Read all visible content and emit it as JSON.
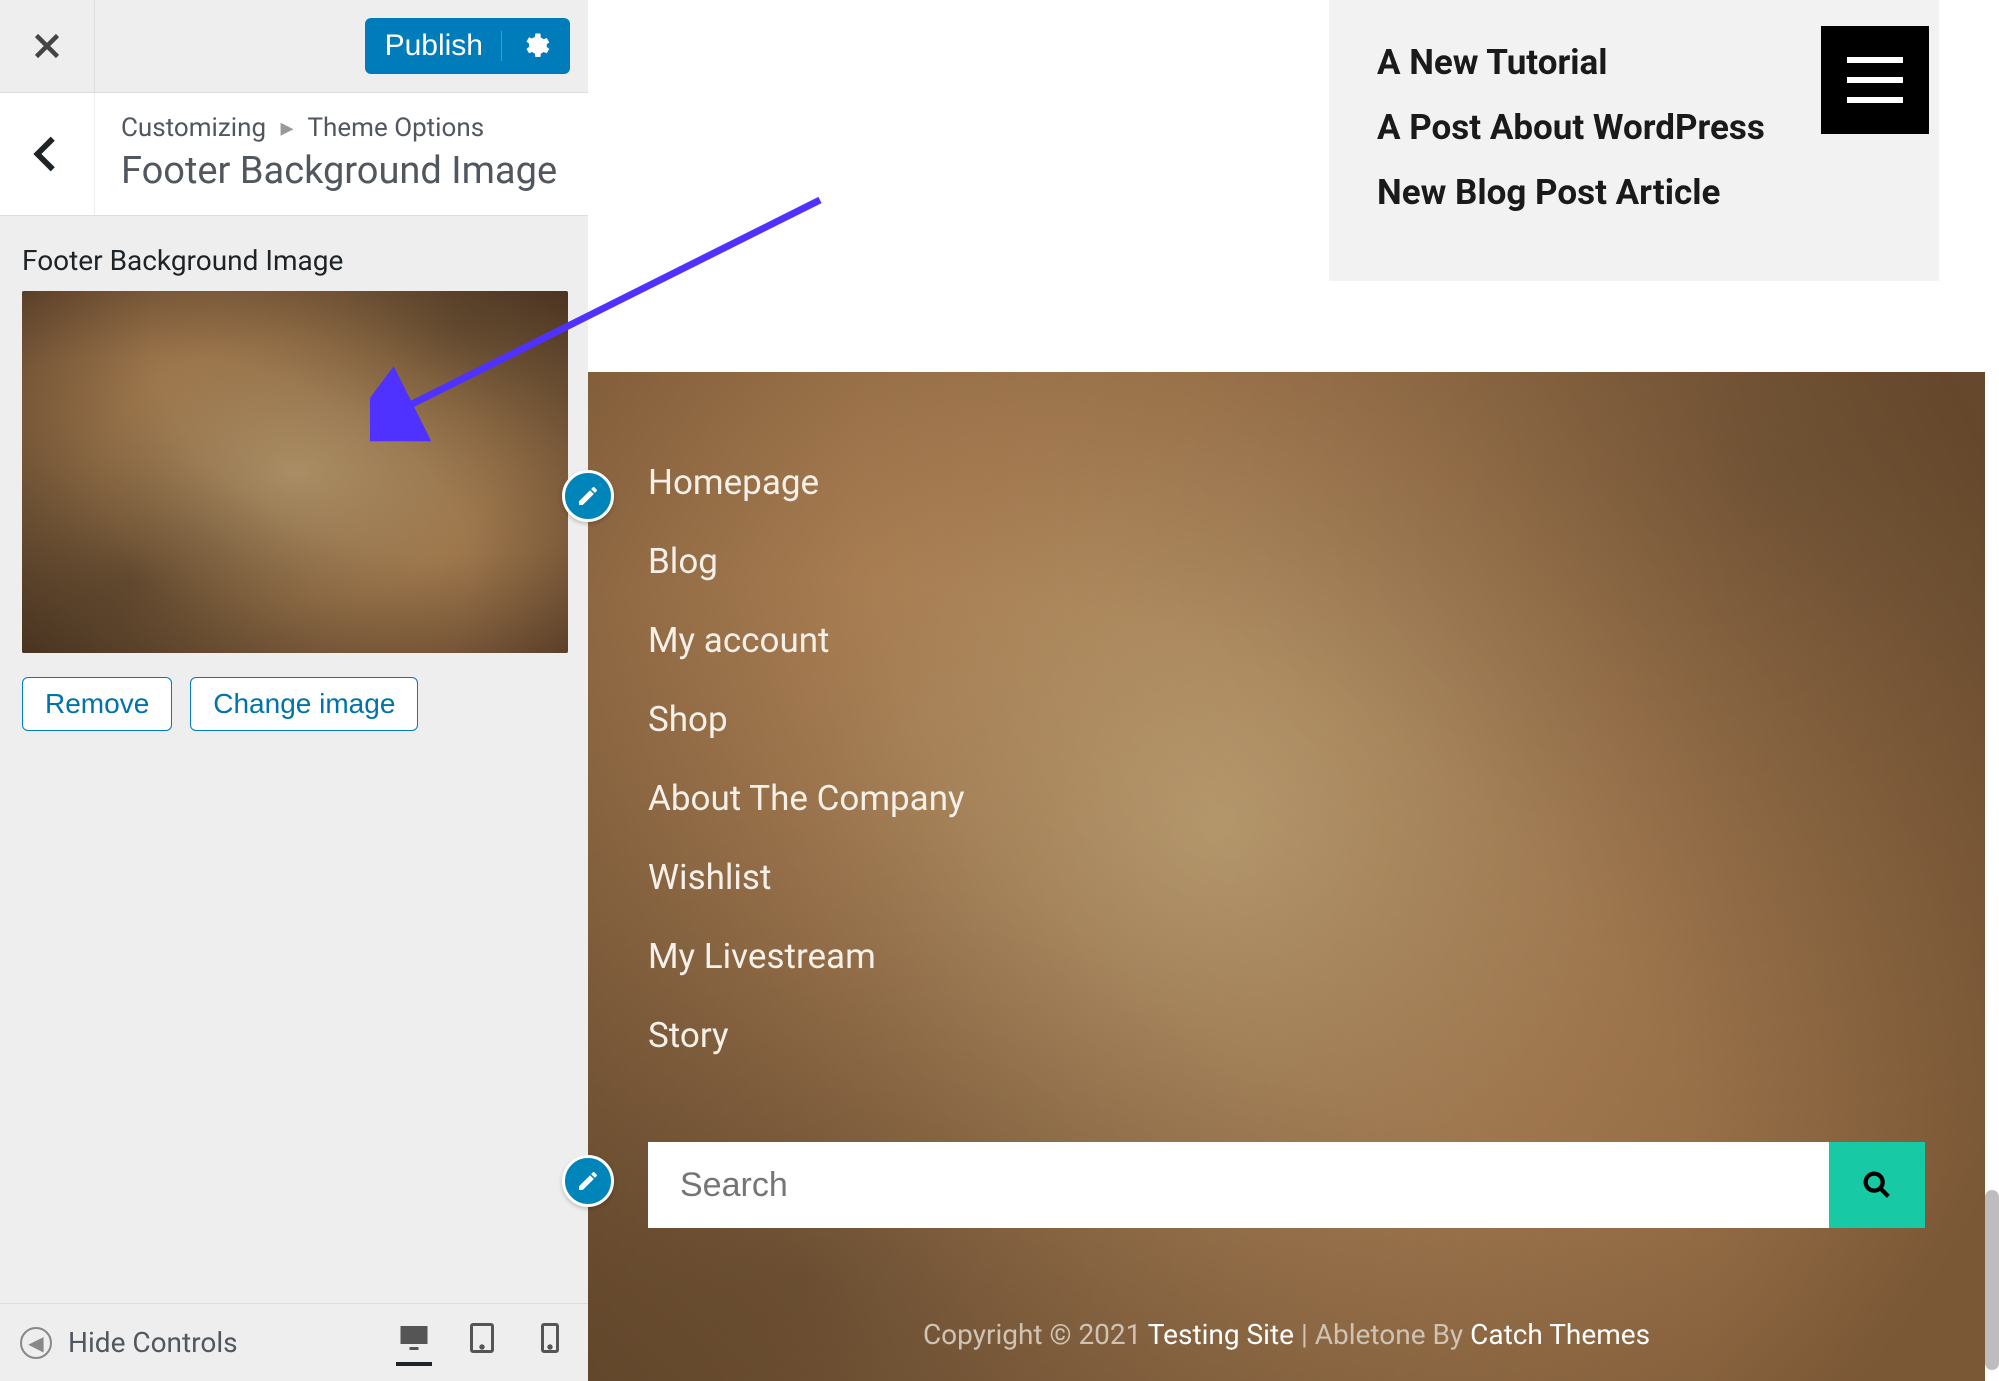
{
  "topbar": {
    "publish_label": "Publish"
  },
  "breadcrumb": {
    "root": "Customizing",
    "parent": "Theme Options"
  },
  "section_title": "Footer Background Image",
  "control": {
    "label": "Footer Background Image",
    "remove_label": "Remove",
    "change_label": "Change image"
  },
  "footerbar": {
    "hide_label": "Hide Controls"
  },
  "recent_posts": [
    "A New Tutorial",
    "A Post About WordPress",
    "New Blog Post Article"
  ],
  "footer_nav": [
    "Homepage",
    "Blog",
    "My account",
    "Shop",
    "About The Company",
    "Wishlist",
    "My Livestream",
    "Story"
  ],
  "search": {
    "placeholder": "Search"
  },
  "copyright": {
    "prefix": "Copyright © 2021 ",
    "site": "Testing Site",
    "mid": " | Abletone By ",
    "theme": "Catch Themes"
  }
}
